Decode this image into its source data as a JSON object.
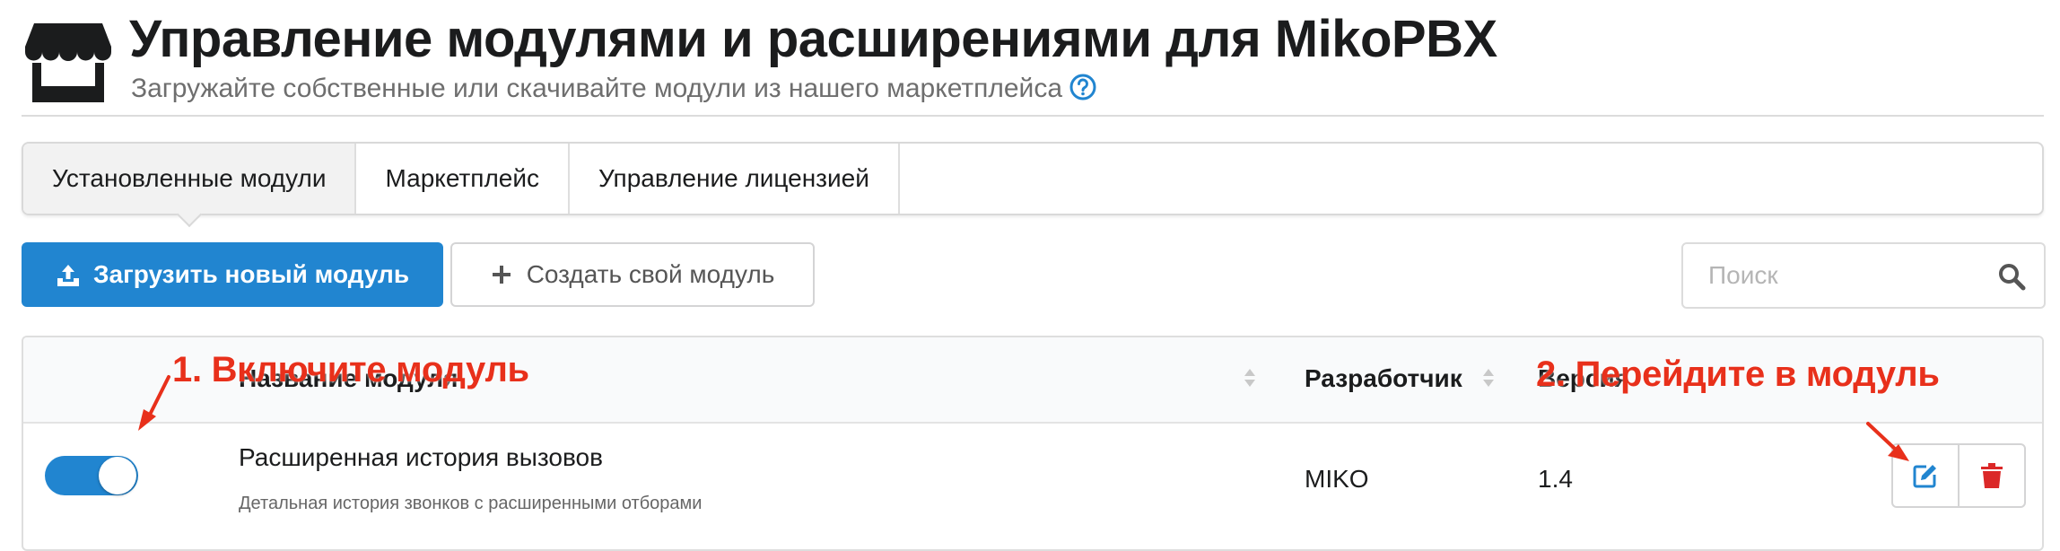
{
  "header": {
    "title": "Управление модулями и расширениями для MikoPBX",
    "subtitle": "Загружайте собственные или скачивайте модули из нашего маркетплейса"
  },
  "tabs": [
    {
      "label": "Установленные модули",
      "active": true
    },
    {
      "label": "Маркетплейс",
      "active": false
    },
    {
      "label": "Управление лицензией",
      "active": false
    }
  ],
  "toolbar": {
    "upload_label": "Загрузить новый модуль",
    "create_label": "Создать свой модуль"
  },
  "search": {
    "placeholder": "Поиск",
    "value": ""
  },
  "table": {
    "columns": {
      "name": "Название модуля",
      "developer": "Разработчик",
      "version": "Версия"
    },
    "rows": [
      {
        "enabled": true,
        "name": "Расширенная история вызовов",
        "description": "Детальная история звонков с расширенными отборами",
        "developer": "MIKO",
        "version": "1.4"
      }
    ]
  },
  "annotations": {
    "step1": "1. Включите модуль",
    "step2": "2. Перейдите в модуль"
  },
  "colors": {
    "primary": "#2185d0",
    "annotation": "#e8301b",
    "delete": "#db2828"
  }
}
